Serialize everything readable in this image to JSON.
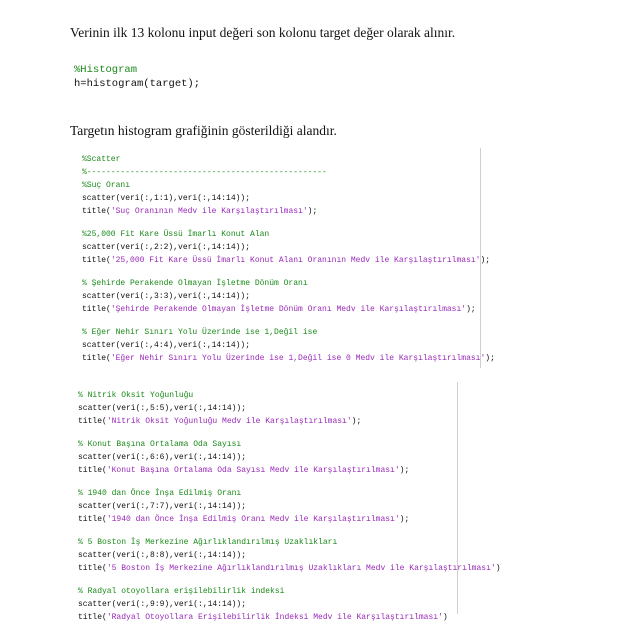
{
  "intro_text": "Verinin ilk 13 kolonu input değeri son kolonu target değer olarak alınır.",
  "histogram_code": [
    {
      "text": "%Histogram",
      "kind": "comment"
    },
    {
      "text": "h=histogram(target);",
      "kind": "code"
    }
  ],
  "histogram_text": "Targetın histogram grafiğinin gösterildiği alandır.",
  "scatter_block_1": [
    {
      "text": "%Scatter",
      "kind": "comment"
    },
    {
      "text": "%--------------------------------------------------",
      "kind": "comment"
    },
    {
      "text": "%Suç Oranı",
      "kind": "comment"
    },
    {
      "text": "scatter(veri(:,1:1),veri(:,14:14));",
      "kind": "code"
    },
    {
      "text": "title('Suç Oranının Medv ile Karşılaştırılması');",
      "kind": "title",
      "prefix": "title(",
      "string": "'Suç Oranının Medv ile Karşılaştırılması'",
      "suffix": ");"
    },
    {
      "text": "",
      "kind": "blank"
    },
    {
      "text": "%25,000 Fit Kare Üssü İmarlı Konut Alan",
      "kind": "comment"
    },
    {
      "text": "scatter(veri(:,2:2),veri(:,14:14));",
      "kind": "code"
    },
    {
      "text": "title('25,000 Fit Kare Üssü İmarlı Konut Alanı Oranının Medv ile Karşılaştırılması');",
      "kind": "title",
      "prefix": "title(",
      "string": "'25,000 Fit Kare Üssü İmarlı Konut Alanı Oranının Medv ile Karşılaştırılması'",
      "suffix": ");"
    },
    {
      "text": "",
      "kind": "blank"
    },
    {
      "text": "% Şehirde Perakende Olmayan İşletme Dönüm Oranı",
      "kind": "comment"
    },
    {
      "text": "scatter(veri(:,3:3),veri(:,14:14));",
      "kind": "code"
    },
    {
      "text": "title('Şehirde Perakende Olmayan İşletme Dönüm Oranı Medv ile Karşılaştırılması');",
      "kind": "title",
      "prefix": "title(",
      "string": "'Şehirde Perakende Olmayan İşletme Dönüm Oranı Medv ile Karşılaştırılması'",
      "suffix": ");"
    },
    {
      "text": "",
      "kind": "blank"
    },
    {
      "text": "% Eğer Nehir Sınırı Yolu Üzerinde ise 1,Değil ise",
      "kind": "comment"
    },
    {
      "text": "scatter(veri(:,4:4),veri(:,14:14));",
      "kind": "code"
    },
    {
      "text": "title('Eğer Nehir Sınırı Yolu Üzerinde ise 1,Değil ise 0 Medv ile Karşılaştırılması');",
      "kind": "title",
      "prefix": "title(",
      "string": "'Eğer Nehir Sınırı Yolu Üzerinde ise 1,Değil ise 0 Medv ile Karşılaştırılması'",
      "suffix": ");"
    }
  ],
  "scatter_block_2": [
    {
      "text": "% Nitrik Oksit Yoğunluğu",
      "kind": "comment"
    },
    {
      "text": "scatter(veri(:,5:5),veri(:,14:14));",
      "kind": "code"
    },
    {
      "text": "title('Nitrik Oksit Yoğunluğu Medv ile Karşılaştırılması');",
      "kind": "title",
      "prefix": "title(",
      "string": "'Nitrik Oksit Yoğunluğu Medv ile Karşılaştırılması'",
      "suffix": ");"
    },
    {
      "text": "",
      "kind": "blank"
    },
    {
      "text": "% Konut Başına Ortalama Oda Sayısı",
      "kind": "comment"
    },
    {
      "text": "scatter(veri(:,6:6),veri(:,14:14));",
      "kind": "code"
    },
    {
      "text": "title('Konut Başına Ortalama Oda Sayısı Medv ile Karşılaştırılması');",
      "kind": "title",
      "prefix": "title(",
      "string": "'Konut Başına Ortalama Oda Sayısı Medv ile Karşılaştırılması'",
      "suffix": ");"
    },
    {
      "text": "",
      "kind": "blank"
    },
    {
      "text": "% 1940 dan Önce İnşa Edilmiş Oranı",
      "kind": "comment"
    },
    {
      "text": "scatter(veri(:,7:7),veri(:,14:14));",
      "kind": "code"
    },
    {
      "text": "title('1940 dan Önce İnşa Edilmiş Oranı Medv ile Karşılaştırılması');",
      "kind": "title",
      "prefix": "title(",
      "string": "'1940 dan Önce İnşa Edilmiş Oranı Medv ile Karşılaştırılması'",
      "suffix": ");"
    },
    {
      "text": "",
      "kind": "blank"
    },
    {
      "text": "% 5 Boston İş Merkezine Ağırlıklandırılmış Uzaklıkları",
      "kind": "comment"
    },
    {
      "text": "scatter(veri(:,8:8),veri(:,14:14));",
      "kind": "code"
    },
    {
      "text": "title('5 Boston İş Merkezine Ağırlıklandırılmış Uzaklıkları Medv ile Karşılaştırılması')",
      "kind": "title",
      "prefix": "title(",
      "string": "'5 Boston İş Merkezine Ağırlıklandırılmış Uzaklıkları Medv ile Karşılaştırılması'",
      "suffix": ")"
    },
    {
      "text": "",
      "kind": "blank"
    },
    {
      "text": "% Radyal otoyollara erişilebilirlik indeksi",
      "kind": "comment"
    },
    {
      "text": "scatter(veri(:,9:9),veri(:,14:14));",
      "kind": "code"
    },
    {
      "text": "title('Radyal Otoyollara Erişilebilirlik İndeksi Medv ile Karşılaştırılması')",
      "kind": "title",
      "prefix": "title(",
      "string": "'Radyal Otoyollara Erişilebilirlik İndeksi Medv ile Karşılaştırılması'",
      "suffix": ")"
    }
  ]
}
